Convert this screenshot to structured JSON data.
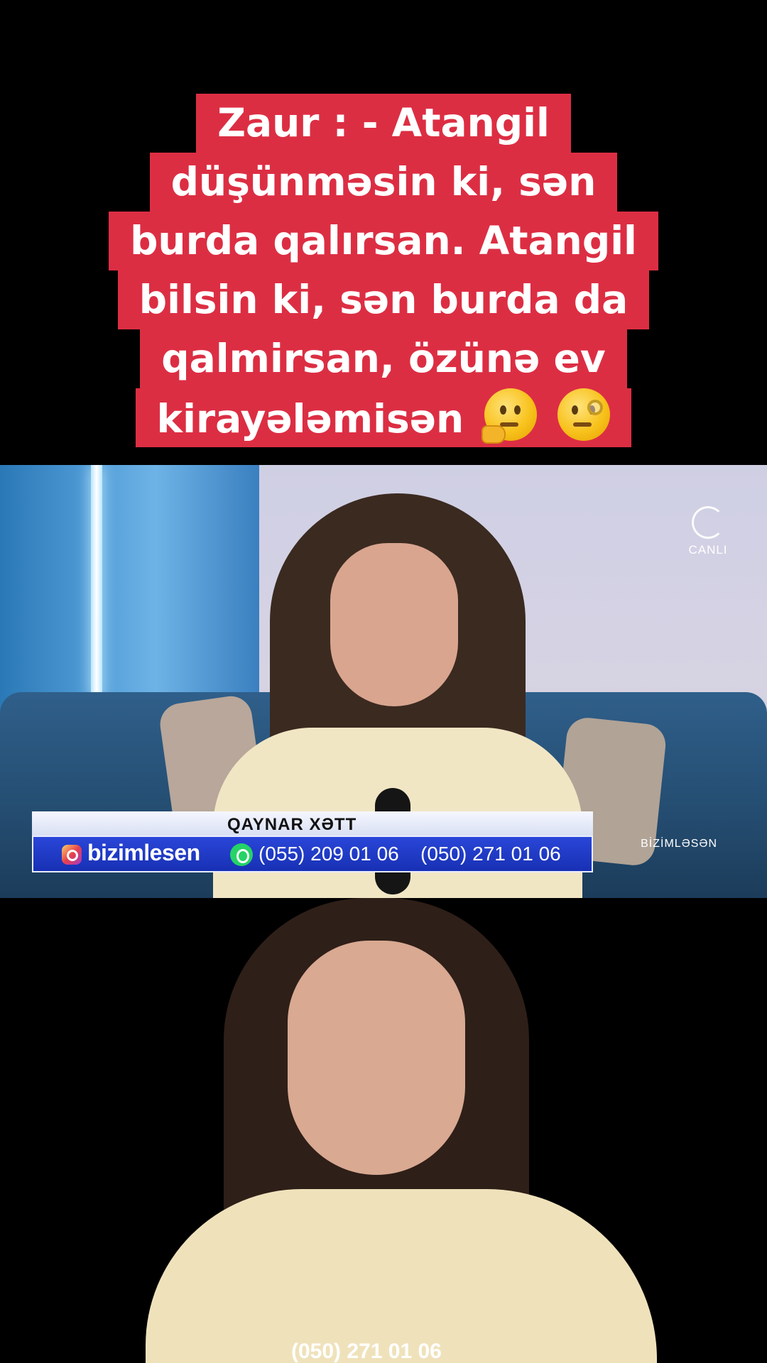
{
  "caption": {
    "lines": [
      "Zaur : - Atangil",
      "düşünməsin ki, sən",
      "burda qalırsan. Atangil",
      "bilsin ki, sən burda da",
      "qalmirsan, özünə ev",
      "kirayələmisən"
    ],
    "emojis": [
      "thinking-face-icon",
      "face-with-monocle-icon"
    ],
    "background_color": "#dc2e43"
  },
  "video_top": {
    "logo_text": "CANLI",
    "brand_right": "BİZİMLƏSƏN",
    "lower_third": {
      "title": "QAYNAR XƏTT",
      "instagram_handle": "bizimlesen",
      "phone_1": "(055) 209 01 06",
      "phone_2": "(050) 271 01 06"
    }
  },
  "video_bottom": {
    "ticker_fragment": "(050) 271 01 06"
  }
}
